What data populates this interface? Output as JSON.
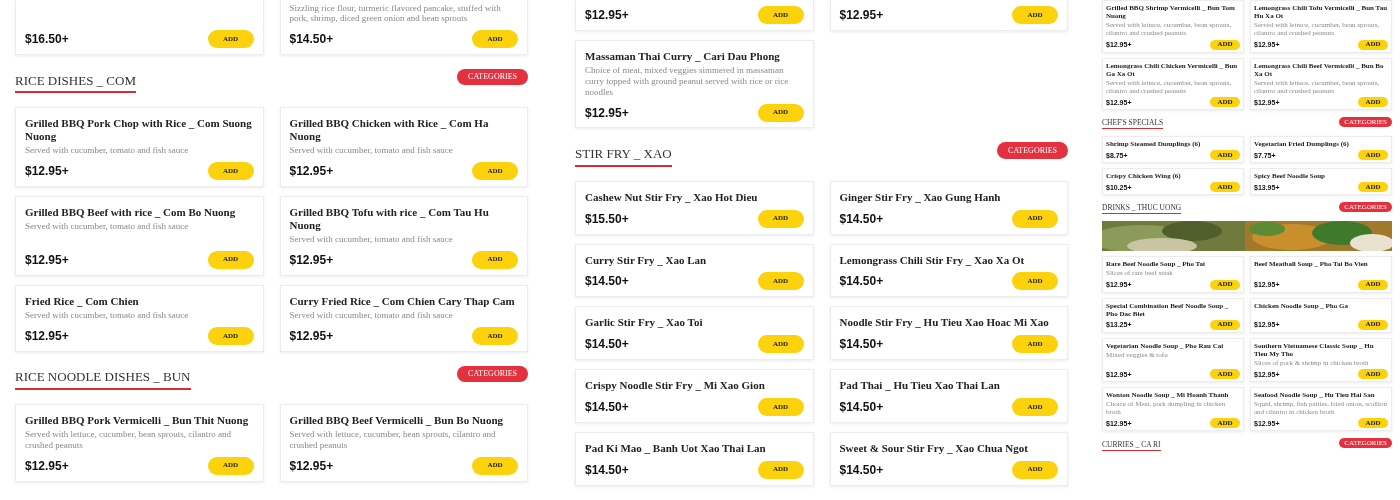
{
  "panels": [
    {
      "blocks": [
        {
          "kind": "cards",
          "cut": true,
          "items": [
            {
              "price": "$16.50+",
              "button": "ADD"
            },
            {
              "description": "Sizzling rice flour, turmeric flavored pancake, stuffed with pork, shrimp, diced green onion and bean sprouts",
              "price": "$14.50+",
              "button": "ADD"
            }
          ]
        },
        {
          "kind": "header",
          "title": "RICE DISHES _ COM",
          "button": "CATEGORIES"
        },
        {
          "kind": "cards",
          "items": [
            {
              "title": "Grilled BBQ Pork Chop with Rice _ Com Suong Nuong",
              "description": "Served with cucumber, tomato and fish sauce",
              "price": "$12.95+",
              "button": "ADD"
            },
            {
              "title": "Grilled BBQ Chicken with Rice _ Com Ha Nuong",
              "description": "Served with cucumber, tomato and fish sauce",
              "price": "$12.95+",
              "button": "ADD"
            }
          ]
        },
        {
          "kind": "cards",
          "items": [
            {
              "title": "Grilled BBQ Beef with rice _ Com Bo Nuong",
              "description": "Served with cucumber, tomato and fish sauce",
              "price": "$12.95+",
              "button": "ADD"
            },
            {
              "title": "Grilled BBQ Tofu with rice _ Com Tau Hu Nuong",
              "description": "Served with cucumber, tomato and fish sauce",
              "price": "$12.95+",
              "button": "ADD"
            }
          ]
        },
        {
          "kind": "cards",
          "items": [
            {
              "title": "Fried Rice _ Com Chien",
              "description": "Served with cucumber, tomato and fish sauce",
              "price": "$12.95+",
              "button": "ADD"
            },
            {
              "title": "Curry Fried Rice _ Com Chien Cary Thap Cam",
              "description": "Served with cucumber, tomato and fish sauce",
              "price": "$12.95+",
              "button": "ADD"
            }
          ]
        },
        {
          "kind": "header",
          "title": "RICE NOODLE DISHES _ BUN",
          "button": "CATEGORIES"
        },
        {
          "kind": "cards",
          "items": [
            {
              "title": "Grilled BBQ Pork Vermicelli _ Bun Thit Nuong",
              "description": "Served with lettuce, cucumber, bean sprouts, cilantro and crushed peanuts",
              "price": "$12.95+",
              "button": "ADD"
            },
            {
              "title": "Grilled BBQ Beef Vermicelli _ Bun Bo Nuong",
              "description": "Served with lettuce, cucumber, bean sprouts, cilantro and crushed peanuts",
              "price": "$12.95+",
              "button": "ADD"
            }
          ]
        }
      ]
    },
    {
      "blocks": [
        {
          "kind": "cards",
          "cut": true,
          "items": [
            {
              "price": "$12.95+",
              "button": "ADD"
            },
            {
              "price": "$12.95+",
              "button": "ADD"
            }
          ]
        },
        {
          "kind": "cards",
          "items": [
            {
              "title": "Massaman Thai Curry _ Cari Dau Phong",
              "description": "Choice of meat, mixed veggies simmered in massaman curry topped with ground peanut served with rice or rice noodles",
              "price": "$12.95+",
              "button": "ADD"
            }
          ]
        },
        {
          "kind": "header",
          "title": "STIR FRY _ XAO",
          "button": "CATEGORIES"
        },
        {
          "kind": "cards",
          "items": [
            {
              "title": "Cashew Nut Stir Fry _ Xao Hot Dieu",
              "price": "$15.50+",
              "button": "ADD"
            },
            {
              "title": "Ginger Stir Fry _ Xao Gung Hanh",
              "price": "$14.50+",
              "button": "ADD"
            }
          ]
        },
        {
          "kind": "cards",
          "items": [
            {
              "title": "Curry Stir Fry _ Xao Lan",
              "price": "$14.50+",
              "button": "ADD"
            },
            {
              "title": "Lemongrass Chili Stir Fry _ Xao Xa Ot",
              "price": "$14.50+",
              "button": "ADD"
            }
          ]
        },
        {
          "kind": "cards",
          "items": [
            {
              "title": "Garlic Stir Fry _ Xao Toi",
              "price": "$14.50+",
              "button": "ADD"
            },
            {
              "title": "Noodle Stir Fry _ Hu Tieu Xao Hoac Mi Xao",
              "price": "$14.50+",
              "button": "ADD"
            }
          ]
        },
        {
          "kind": "cards",
          "items": [
            {
              "title": "Crispy Noodle Stir Fry _ Mi Xao Gion",
              "price": "$14.50+",
              "button": "ADD"
            },
            {
              "title": "Pad Thai _ Hu Tieu Xao Thai Lan",
              "price": "$14.50+",
              "button": "ADD"
            }
          ]
        },
        {
          "kind": "cards",
          "items": [
            {
              "title": "Pad Ki Mao _ Banh Uot Xao Thai Lan",
              "price": "$14.50+",
              "button": "ADD"
            },
            {
              "title": "Sweet & Sour Stir Fry _ Xao Chua Ngot",
              "price": "$14.50+",
              "button": "ADD"
            }
          ]
        }
      ]
    },
    {
      "blocks": [
        {
          "kind": "cards",
          "items": [
            {
              "title": "Grilled BBQ Shrimp Vermicelli _ Bun Tom Nuong",
              "description": "Served with lettuce, cucumber, bean sprouts, cilantro and crushed peanuts",
              "price": "$12.95+",
              "button": "ADD"
            },
            {
              "title": "Lemongrass Chili Tofu Vermicelli _ Bun Tau Hu Xa Ot",
              "description": "Served with lettuce, cucumber, bean sprouts, cilantro and crushed peanuts",
              "price": "$12.95+",
              "button": "ADD"
            }
          ]
        },
        {
          "kind": "cards",
          "items": [
            {
              "title": "Lemongrass Chili Chicken Vermicelli _ Bun Ga Xa Ot",
              "description": "Served with lettuce, cucumber, bean sprouts, cilantro and crushed peanuts",
              "price": "$12.95+",
              "button": "ADD"
            },
            {
              "title": "Lemongrass Chili Beef Vermicelli _ Bun Bo Xa Ot",
              "description": "Served with lettuce, cucumber, bean sprouts, cilantro and crushed peanuts",
              "price": "$12.95+",
              "button": "ADD"
            }
          ]
        },
        {
          "kind": "header",
          "title": "CHEF'S SPECIALS",
          "button": "CATEGORIES"
        },
        {
          "kind": "cards",
          "items": [
            {
              "title": "Shrimp Steamed Dumplings (6)",
              "price": "$8.75+",
              "button": "ADD"
            },
            {
              "title": "Vegetarian Fried Dumplings (6)",
              "price": "$7.75+",
              "button": "ADD"
            }
          ]
        },
        {
          "kind": "cards",
          "items": [
            {
              "title": "Crispy Chicken Wing (6)",
              "price": "$10.25+",
              "button": "ADD"
            },
            {
              "title": "Spicy Beef Noodle Soup",
              "price": "$13.95+",
              "button": "ADD"
            }
          ]
        },
        {
          "kind": "header",
          "title": "DRINKS _ THUC UONG",
          "button": "CATEGORIES"
        },
        {
          "kind": "picture"
        },
        {
          "kind": "cards",
          "items": [
            {
              "title": "Rare Beef Noodle Soup _ Pho Tai",
              "description": "Slices of rare beef steak",
              "price": "$12.95+",
              "button": "ADD"
            },
            {
              "title": "Beef Meatball Soup _ Pho Tai Bo Vien",
              "price": "$12.95+",
              "button": "ADD"
            }
          ]
        },
        {
          "kind": "cards",
          "items": [
            {
              "title": "Special Combination Beef Noodle Soup _ Pho Dac Biet",
              "price": "$13.25+",
              "button": "ADD"
            },
            {
              "title": "Chicken Noodle Soup _ Pho Ga",
              "price": "$12.95+",
              "button": "ADD"
            }
          ]
        },
        {
          "kind": "cards",
          "items": [
            {
              "title": "Vegetarian Noodle Soup _ Pho Rau Cai",
              "description": "Mixed veggies & tofu",
              "price": "$12.95+",
              "button": "ADD"
            },
            {
              "title": "Southern Vietnamese Classic Soup _ Hu Tieu My Tho",
              "description": "Slices of pork & shrimp in chicken broth",
              "price": "$12.95+",
              "button": "ADD"
            }
          ]
        },
        {
          "kind": "cards",
          "items": [
            {
              "title": "Wonton Noodle Soup _ Mi Hoanh Thanh",
              "description": "Choice of Meat, pork dumpling in chicken broth",
              "price": "$12.95+",
              "button": "ADD"
            },
            {
              "title": "Seafood Noodle Soup _ Hu Tieu Hai San",
              "description": "Squid, shrimp, fish patties, fried onion, scallion and cilantro in chicken broth",
              "price": "$12.95+",
              "button": "ADD"
            }
          ]
        },
        {
          "kind": "header",
          "title": "CURRIES _ CA RI",
          "button": "CATEGORIES"
        }
      ]
    }
  ]
}
